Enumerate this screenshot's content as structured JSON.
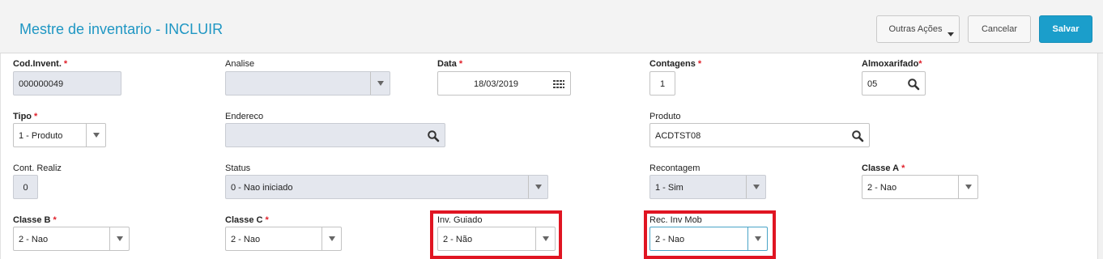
{
  "header": {
    "title": "Mestre de inventario - INCLUIR",
    "buttons": {
      "outras": "Outras Ações",
      "cancelar": "Cancelar",
      "salvar": "Salvar"
    }
  },
  "form": {
    "required_mark": "*",
    "cod_invent": {
      "label": "Cod.Invent.",
      "value": "000000049"
    },
    "analise": {
      "label": "Analise",
      "value": ""
    },
    "data": {
      "label": "Data",
      "value": "18/03/2019"
    },
    "contagens": {
      "label": "Contagens",
      "value": "1"
    },
    "almoxarifado": {
      "label": "Almoxarifado",
      "value": "05"
    },
    "tipo": {
      "label": "Tipo",
      "value": "1 - Produto"
    },
    "endereco": {
      "label": "Endereco",
      "value": ""
    },
    "produto": {
      "label": "Produto",
      "value": "ACDTST08"
    },
    "cont_realiz": {
      "label": "Cont. Realiz",
      "value": "0"
    },
    "status": {
      "label": "Status",
      "value": "0 - Nao iniciado"
    },
    "recontagem": {
      "label": "Recontagem",
      "value": "1 - Sim"
    },
    "classe_a": {
      "label": "Classe A",
      "value": "2 - Nao"
    },
    "classe_b": {
      "label": "Classe B",
      "value": "2 - Nao"
    },
    "classe_c": {
      "label": "Classe C",
      "value": "2 - Nao"
    },
    "inv_guiado": {
      "label": "Inv. Guiado",
      "value": "2 - Não"
    },
    "rec_inv_mob": {
      "label": "Rec. Inv Mob",
      "value": "2 - Nao"
    }
  },
  "colors": {
    "title": "#1e96c3",
    "primary": "#1b9ecb",
    "required": "#e0202a",
    "highlight": "#e01522"
  },
  "icons": [
    "caret-down-icon",
    "calendar-icon",
    "search-icon",
    "dropdown-arrow-icon"
  ]
}
